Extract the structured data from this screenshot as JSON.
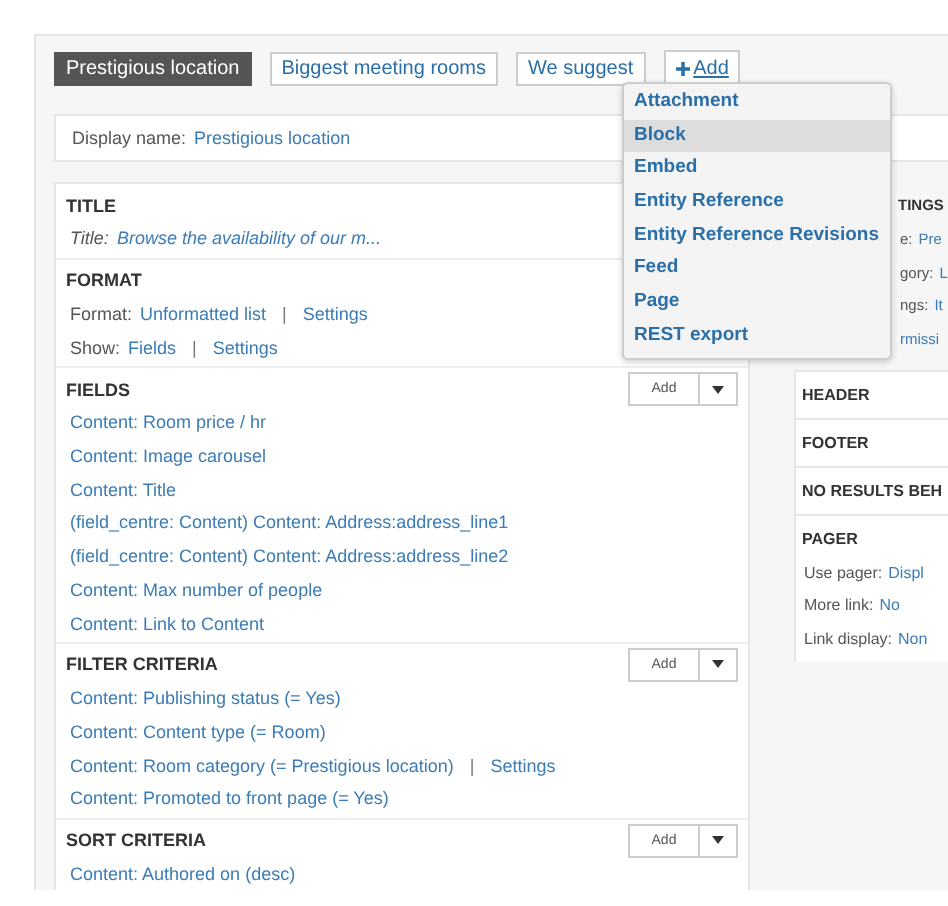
{
  "tabs": [
    {
      "label": "Prestigious location",
      "selected": true
    },
    {
      "label": "Biggest meeting rooms",
      "selected": false
    },
    {
      "label": "We suggest",
      "selected": false
    }
  ],
  "add_link": {
    "label": "Add"
  },
  "add_menu": [
    {
      "label": "Attachment",
      "selected": false
    },
    {
      "label": "Block",
      "selected": true
    },
    {
      "label": "Embed",
      "selected": false
    },
    {
      "label": "Entity Reference",
      "selected": false
    },
    {
      "label": "Entity Reference Revisions",
      "selected": false
    },
    {
      "label": "Feed",
      "selected": false
    },
    {
      "label": "Page",
      "selected": false
    },
    {
      "label": "REST export",
      "selected": false
    }
  ],
  "display_name": {
    "label": "Display name:",
    "value": "Prestigious location"
  },
  "left_sections": [
    {
      "heading": "TITLE",
      "rows": [
        {
          "label": "Title:",
          "links": [
            "Browse the availability of our m..."
          ],
          "italic": true
        }
      ]
    },
    {
      "heading": "FORMAT",
      "rows": [
        {
          "label": "Format:",
          "links": [
            "Unformatted list",
            "Settings"
          ],
          "separator": "|"
        },
        {
          "label": "Show:",
          "links": [
            "Fields",
            "Settings"
          ],
          "separator": "|"
        }
      ]
    },
    {
      "heading": "FIELDS",
      "add_button": "Add",
      "rows": [
        {
          "links": [
            "Content: Room price / hr"
          ]
        },
        {
          "links": [
            "Content: Image carousel"
          ]
        },
        {
          "links": [
            "Content: Title"
          ]
        },
        {
          "links": [
            "(field_centre: Content) Content: Address:address_line1"
          ]
        },
        {
          "links": [
            "(field_centre: Content) Content: Address:address_line2"
          ]
        },
        {
          "links": [
            "Content: Max number of people"
          ]
        },
        {
          "links": [
            "Content: Link to Content"
          ]
        }
      ]
    },
    {
      "heading": "FILTER CRITERIA",
      "add_button": "Add",
      "rows": [
        {
          "links": [
            "Content: Publishing status (= Yes)"
          ]
        },
        {
          "links": [
            "Content: Content type (= Room)"
          ]
        },
        {
          "links": [
            "Content: Room category (= Prestigious location)",
            "Settings"
          ],
          "separator": "|"
        },
        {
          "links": [
            "Content: Promoted to front page (= Yes)"
          ]
        }
      ]
    },
    {
      "heading": "SORT CRITERIA",
      "add_button": "Add",
      "rows": [
        {
          "links": [
            "Content: Authored on (desc)"
          ]
        }
      ]
    }
  ],
  "right_sections": [
    {
      "heading": "TINGS",
      "rows": [
        {
          "label": "e:",
          "links": [
            "Pre"
          ]
        },
        {
          "label": "gory:",
          "links": [
            "L"
          ]
        },
        {
          "label": "ngs:",
          "links": [
            "It"
          ]
        },
        {
          "links": [
            "rmissi"
          ]
        }
      ]
    },
    {
      "heading": "HEADER"
    },
    {
      "heading": "FOOTER"
    },
    {
      "heading": "NO RESULTS BEH"
    },
    {
      "heading": "PAGER",
      "rows": [
        {
          "label": "Use pager:",
          "links": [
            "Displ"
          ]
        },
        {
          "label": "More link:",
          "links": [
            "No"
          ]
        },
        {
          "label": "Link display:",
          "links": [
            "Non"
          ]
        }
      ]
    }
  ]
}
